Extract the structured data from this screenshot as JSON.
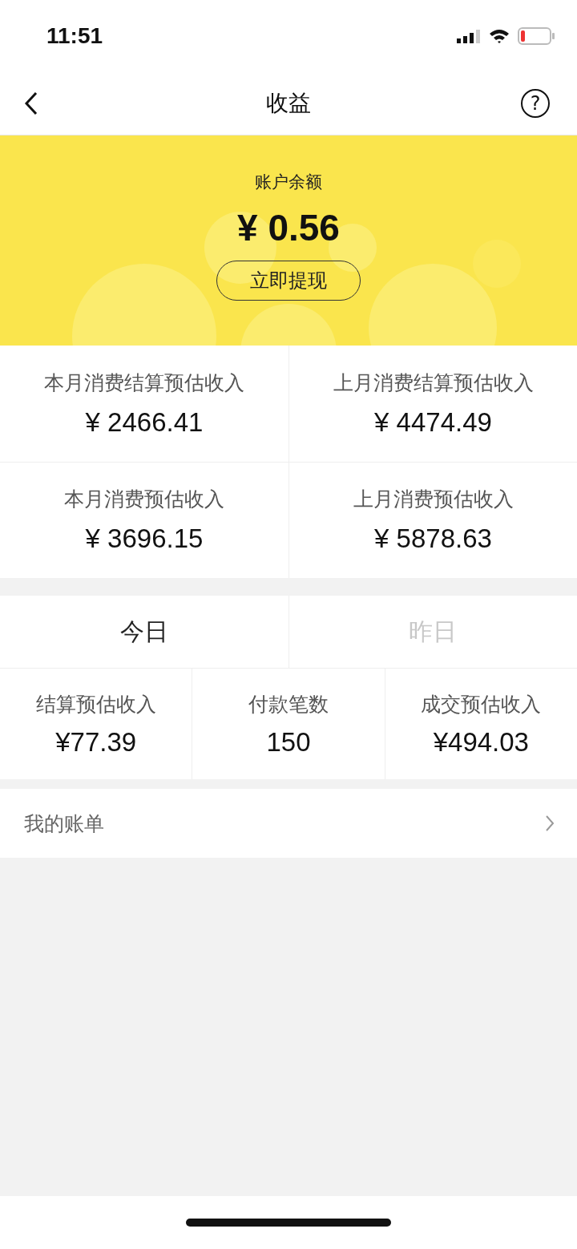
{
  "status_bar": {
    "time": "11:51"
  },
  "header": {
    "title": "收益",
    "help": "?"
  },
  "balance": {
    "label": "账户余额",
    "amount": "¥ 0.56",
    "button": "立即提现"
  },
  "estimates": [
    {
      "label": "本月消费结算预估收入",
      "value": "¥ 2466.41"
    },
    {
      "label": "上月消费结算预估收入",
      "value": "¥ 4474.49"
    },
    {
      "label": "本月消费预估收入",
      "value": "¥ 3696.15"
    },
    {
      "label": "上月消费预估收入",
      "value": "¥ 5878.63"
    }
  ],
  "tabs": [
    {
      "label": "今日",
      "selected": true
    },
    {
      "label": "昨日",
      "selected": false
    }
  ],
  "metrics": [
    {
      "label": "结算预估收入",
      "value": "¥77.39"
    },
    {
      "label": "付款笔数",
      "value": "150"
    },
    {
      "label": "成交预估收入",
      "value": "¥494.03"
    }
  ],
  "bill": {
    "label": "我的账单"
  }
}
